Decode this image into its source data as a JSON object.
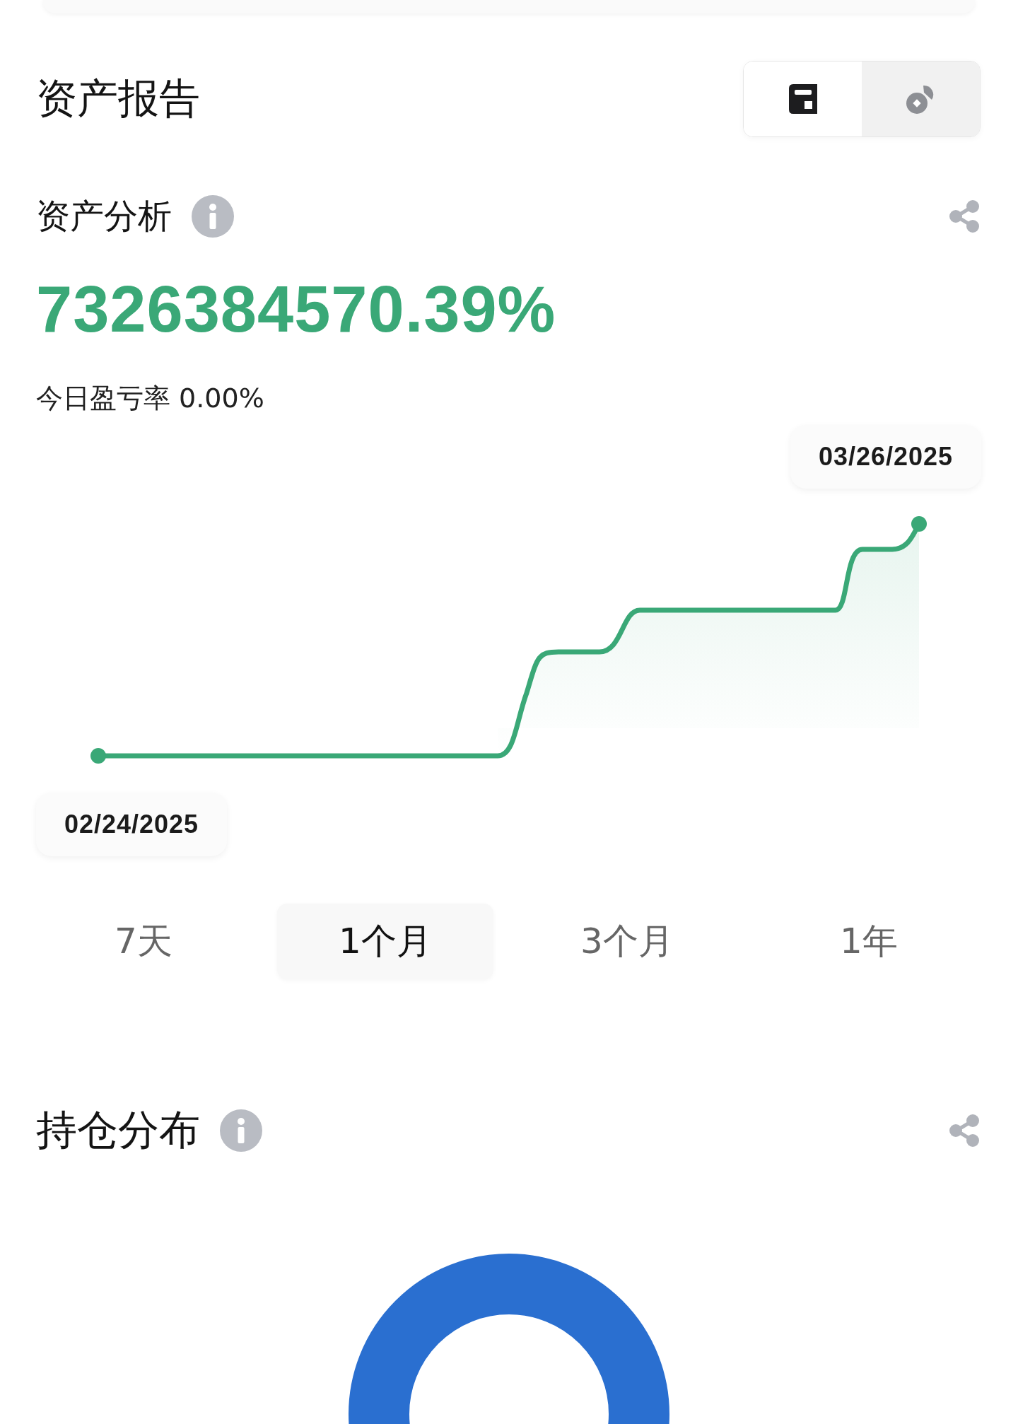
{
  "report": {
    "title": "资产报告",
    "view_toggle": [
      {
        "kind": "layout",
        "selected": true
      },
      {
        "kind": "coins",
        "selected": false
      }
    ]
  },
  "analysis": {
    "title": "资产分析",
    "return_rate": "7326384570.39%",
    "today_label": "今日盈亏率",
    "today_value": "0.00%",
    "end_date": "03/26/2025",
    "start_date": "02/24/2025",
    "periods": [
      {
        "label": "7天",
        "selected": false
      },
      {
        "label": "1个月",
        "selected": true
      },
      {
        "label": "3个月",
        "selected": false
      },
      {
        "label": "1年",
        "selected": false
      }
    ]
  },
  "holdings": {
    "title": "持仓分布"
  }
}
